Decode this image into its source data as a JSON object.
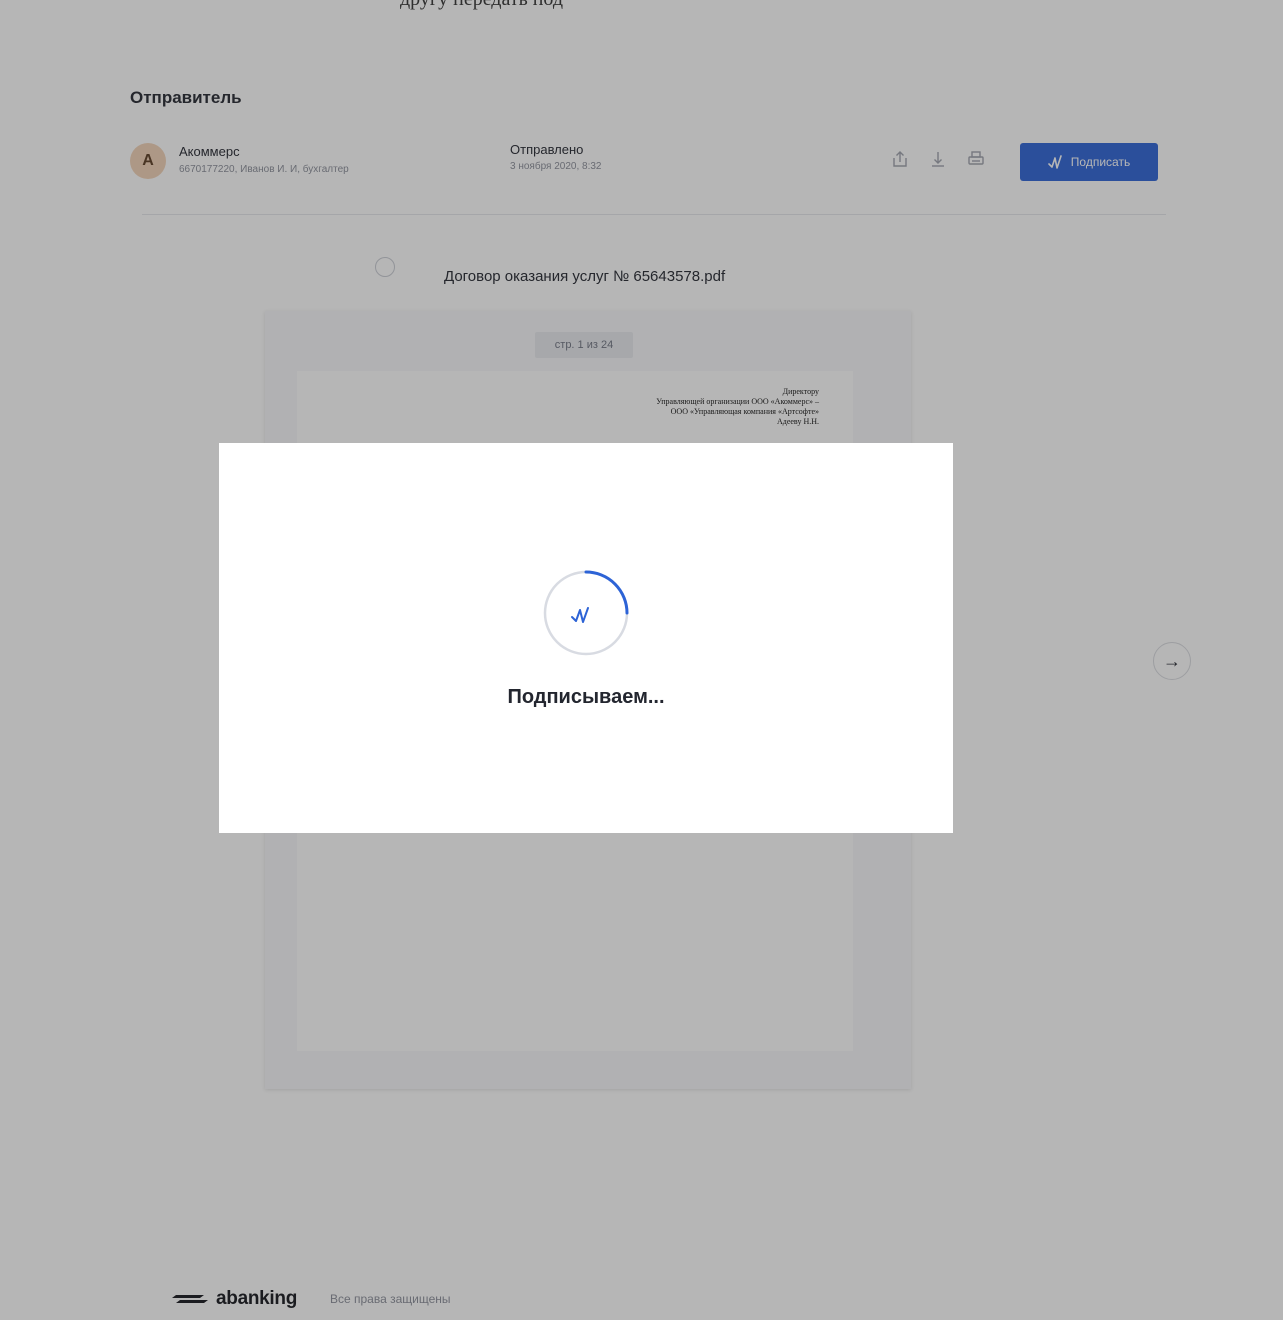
{
  "browser": {
    "top_text": "другу передать под"
  },
  "sender_section": {
    "title": "Отправитель",
    "avatar_letter": "А",
    "name": "Акоммерс",
    "meta": "6670177220, Иванов И. И, бухгалтер",
    "sent_label": "Отправлено",
    "sent_date": "3 ноября 2020, 8:32"
  },
  "toolbar": {
    "icons": [
      "share-icon",
      "download-icon",
      "print-icon"
    ],
    "sign_button_label": "Подписать"
  },
  "document": {
    "file_name": "Договор оказания услуг № 65643578.pdf",
    "page_counter": "стр. 1 из 24",
    "addressee_lines": [
      "Директору",
      "Управляющей организации ООО «Акоммерс» –",
      "ООО «Управляющая компания «Артсофте»",
      "Адееву Н.Н."
    ]
  },
  "navigation": {
    "next_arrow": "→"
  },
  "footer": {
    "brand": "abanking",
    "rights": "Все права защищены"
  },
  "modal": {
    "status_text": "Подписываем..."
  },
  "colors": {
    "accent": "#2d63d6",
    "avatar_bg": "#f2d2b6",
    "spinner_track": "#d8dbe2"
  }
}
